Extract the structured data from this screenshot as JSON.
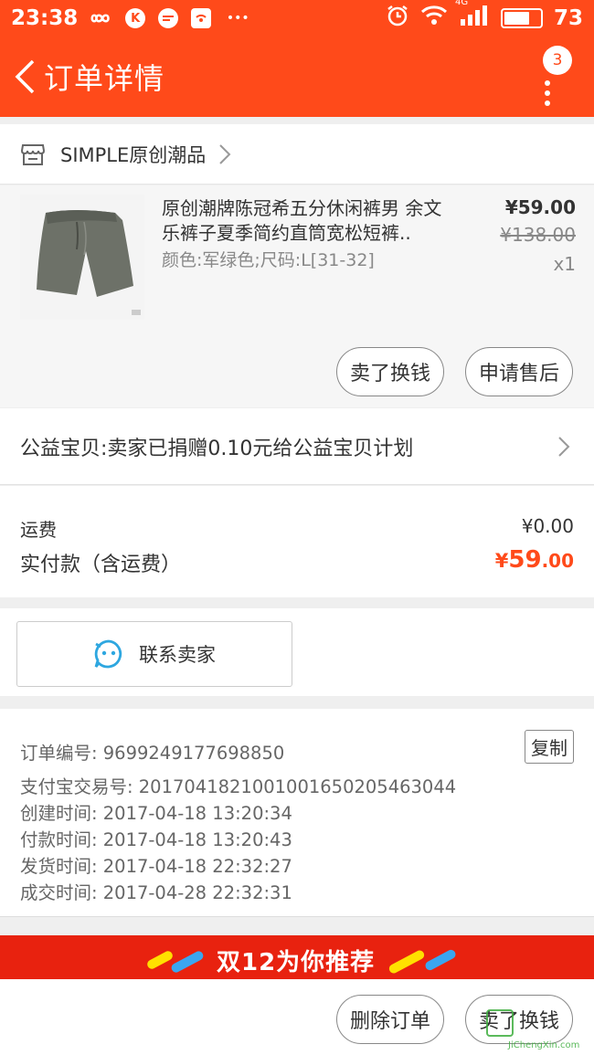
{
  "status_bar": {
    "time": "23:38",
    "left_icons": [
      "infinity-icon",
      "k-app-icon",
      "chat-app-icon",
      "wifi-hotspot-icon",
      "more-notifications-icon"
    ],
    "k_label": "K",
    "ellipsis": "•••",
    "network": "4G",
    "battery_level": 0.73,
    "battery_text": "73"
  },
  "header": {
    "title": "订单详情",
    "more_badge": "3"
  },
  "shop": {
    "name": "SIMPLE原创潮品"
  },
  "product": {
    "title": "原创潮牌陈冠希五分休闲裤男 余文乐裤子夏季简约直筒宽松短裤..",
    "sku": "颜色:军绿色;尺码:L[31-32]",
    "price": "¥59.00",
    "original_price": "¥138.00",
    "quantity": "x1",
    "sell_button": "卖了换钱",
    "after_sale_button": "申请售后"
  },
  "charity": {
    "text": "公益宝贝:卖家已捐赠0.10元给公益宝贝计划"
  },
  "payment": {
    "shipping_label": "运费",
    "shipping_value": "¥0.00",
    "paid_label": "实付款（含运费）",
    "paid_currency": "¥",
    "paid_integer": "59",
    "paid_decimal": ".00",
    "accent_color": "#ff4a1a"
  },
  "contact": {
    "label": "联系卖家"
  },
  "order_info": {
    "copy_button": "复制",
    "lines": [
      "订单编号: 9699249177698850",
      "支付宝交易号: 2017041821001001650205463044",
      "创建时间: 2017-04-18 13:20:34",
      "付款时间: 2017-04-18 13:20:43",
      "发货时间: 2017-04-18 22:32:27",
      "成交时间: 2017-04-28 22:32:31"
    ]
  },
  "banner": {
    "text": "双12为你推荐"
  },
  "bottom_bar": {
    "delete_button": "删除订单",
    "sell_button": "卖了换钱"
  },
  "watermark": {
    "text": "JiChengXin.com"
  }
}
